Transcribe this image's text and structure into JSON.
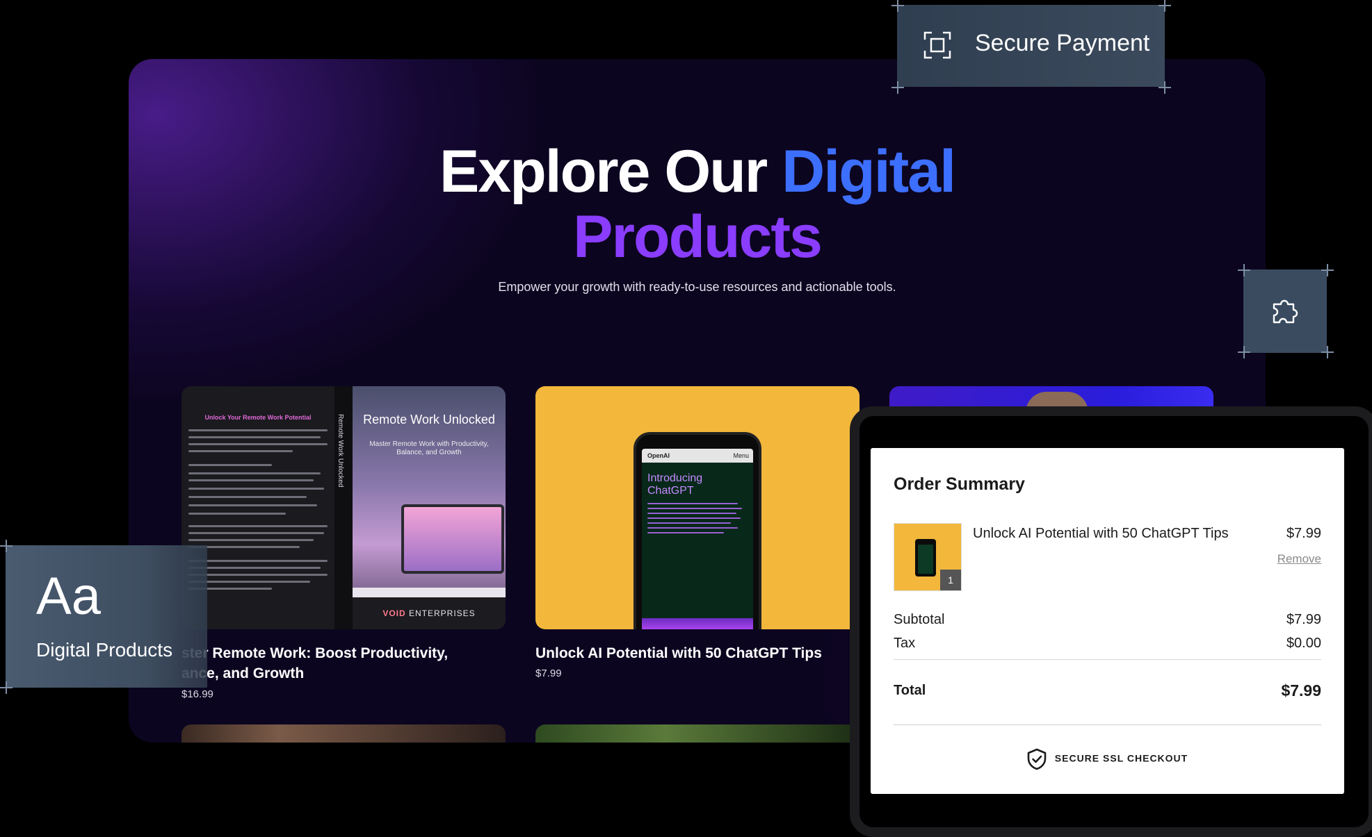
{
  "hero": {
    "title_part1": "Explore Our ",
    "title_part2": "Digital",
    "title_part3": "Products",
    "subtitle": "Empower your growth with ready-to-use resources and actionable tools.",
    "colors": {
      "blue": "#3d6fff",
      "purple": "#8a3dff",
      "background": "#0c0520"
    }
  },
  "products": [
    {
      "title_line1": "ster Remote Work: Boost Productivity,",
      "title_line2": "ance, and Growth",
      "price": "$16.99",
      "cover": {
        "left_heading": "Unlock Your Remote Work Potential",
        "spine": "Remote Work Unlocked",
        "title": "Remote Work Unlocked",
        "subtitle_line1": "Master Remote Work with Productivity,",
        "subtitle_line2": "Balance, and Growth",
        "brand_bold": "VOID",
        "brand_rest": " ENTERPRISES"
      }
    },
    {
      "title": "Unlock AI Potential with 50 ChatGPT Tips",
      "price": "$7.99",
      "cover": {
        "app_name": "OpenAI",
        "menu": "Menu",
        "heading_line1": "Introducing",
        "heading_line2": "ChatGPT"
      }
    }
  ],
  "tags": {
    "secure_payment": "Secure Payment",
    "font_sample": "Aa",
    "font_label": "Digital Products",
    "icons": {
      "payment": "scan-frame-icon",
      "puzzle": "puzzle-icon"
    }
  },
  "order_summary": {
    "title": "Order Summary",
    "item": {
      "name": "Unlock AI Potential with 50 ChatGPT Tips",
      "price": "$7.99",
      "quantity": "1",
      "remove_label": "Remove"
    },
    "subtotal_label": "Subtotal",
    "subtotal_value": "$7.99",
    "tax_label": "Tax",
    "tax_value": "$0.00",
    "total_label": "Total",
    "total_value": "$7.99",
    "secure_label": "SECURE SSL CHECKOUT"
  }
}
